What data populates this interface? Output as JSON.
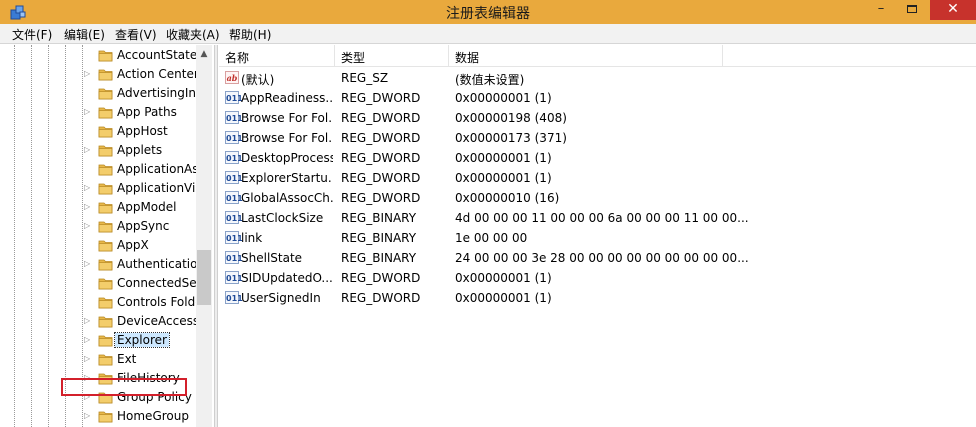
{
  "window": {
    "title": "注册表编辑器",
    "minimize_glyph": "–",
    "close_glyph": "✕"
  },
  "menu": [
    {
      "label": "文件(F)"
    },
    {
      "label": "编辑(E)"
    },
    {
      "label": "查看(V)"
    },
    {
      "label": "收藏夹(A)"
    },
    {
      "label": "帮助(H)"
    }
  ],
  "tree": {
    "items": [
      {
        "label": "AccountState",
        "expandable": false,
        "selected": false
      },
      {
        "label": "Action Center",
        "expandable": true,
        "selected": false
      },
      {
        "label": "AdvertisingInfo",
        "expandable": false,
        "selected": false
      },
      {
        "label": "App Paths",
        "expandable": true,
        "selected": false
      },
      {
        "label": "AppHost",
        "expandable": false,
        "selected": false
      },
      {
        "label": "Applets",
        "expandable": true,
        "selected": false
      },
      {
        "label": "ApplicationAssociationToasts",
        "expandable": false,
        "selected": false
      },
      {
        "label": "ApplicationView",
        "expandable": true,
        "selected": false
      },
      {
        "label": "AppModel",
        "expandable": true,
        "selected": false
      },
      {
        "label": "AppSync",
        "expandable": true,
        "selected": false
      },
      {
        "label": "AppX",
        "expandable": false,
        "selected": false
      },
      {
        "label": "Authentication",
        "expandable": true,
        "selected": false
      },
      {
        "label": "ConnectedSearch",
        "expandable": false,
        "selected": false
      },
      {
        "label": "Controls Folder",
        "expandable": false,
        "selected": false
      },
      {
        "label": "DeviceAccess",
        "expandable": true,
        "selected": false
      },
      {
        "label": "Explorer",
        "expandable": true,
        "selected": true
      },
      {
        "label": "Ext",
        "expandable": true,
        "selected": false
      },
      {
        "label": "FileHistory",
        "expandable": true,
        "selected": false
      },
      {
        "label": "Group Policy",
        "expandable": true,
        "selected": false
      },
      {
        "label": "HomeGroup",
        "expandable": true,
        "selected": false
      }
    ]
  },
  "list": {
    "columns": {
      "name": "名称",
      "type": "类型",
      "data": "数据"
    },
    "rows": [
      {
        "icon": "string-value-icon",
        "icon_text": "ab",
        "name": "(默认)",
        "type": "REG_SZ",
        "data": "(数值未设置)"
      },
      {
        "icon": "binary-value-icon",
        "icon_text": "011",
        "name": "AppReadiness...",
        "type": "REG_DWORD",
        "data": "0x00000001 (1)"
      },
      {
        "icon": "binary-value-icon",
        "icon_text": "011",
        "name": "Browse For Fol...",
        "type": "REG_DWORD",
        "data": "0x00000198 (408)"
      },
      {
        "icon": "binary-value-icon",
        "icon_text": "011",
        "name": "Browse For Fol...",
        "type": "REG_DWORD",
        "data": "0x00000173 (371)"
      },
      {
        "icon": "binary-value-icon",
        "icon_text": "011",
        "name": "DesktopProcess",
        "type": "REG_DWORD",
        "data": "0x00000001 (1)"
      },
      {
        "icon": "binary-value-icon",
        "icon_text": "011",
        "name": "ExplorerStartu...",
        "type": "REG_DWORD",
        "data": "0x00000001 (1)"
      },
      {
        "icon": "binary-value-icon",
        "icon_text": "011",
        "name": "GlobalAssocCh...",
        "type": "REG_DWORD",
        "data": "0x00000010 (16)"
      },
      {
        "icon": "binary-value-icon",
        "icon_text": "011",
        "name": "LastClockSize",
        "type": "REG_BINARY",
        "data": "4d 00 00 00 11 00 00 00 6a 00 00 00 11 00 00..."
      },
      {
        "icon": "binary-value-icon",
        "icon_text": "011",
        "name": "link",
        "type": "REG_BINARY",
        "data": "1e 00 00 00"
      },
      {
        "icon": "binary-value-icon",
        "icon_text": "011",
        "name": "ShellState",
        "type": "REG_BINARY",
        "data": "24 00 00 00 3e 28 00 00 00 00 00 00 00 00 00..."
      },
      {
        "icon": "binary-value-icon",
        "icon_text": "011",
        "name": "SIDUpdatedO...",
        "type": "REG_DWORD",
        "data": "0x00000001 (1)"
      },
      {
        "icon": "binary-value-icon",
        "icon_text": "011",
        "name": "UserSignedIn",
        "type": "REG_DWORD",
        "data": "0x00000001 (1)"
      }
    ]
  },
  "colors": {
    "titlebar": "#e9a93d",
    "close_button": "#c7322c",
    "selection": "#cde8ff",
    "highlight_box": "#d3202b",
    "folder": "#e8b84a"
  }
}
